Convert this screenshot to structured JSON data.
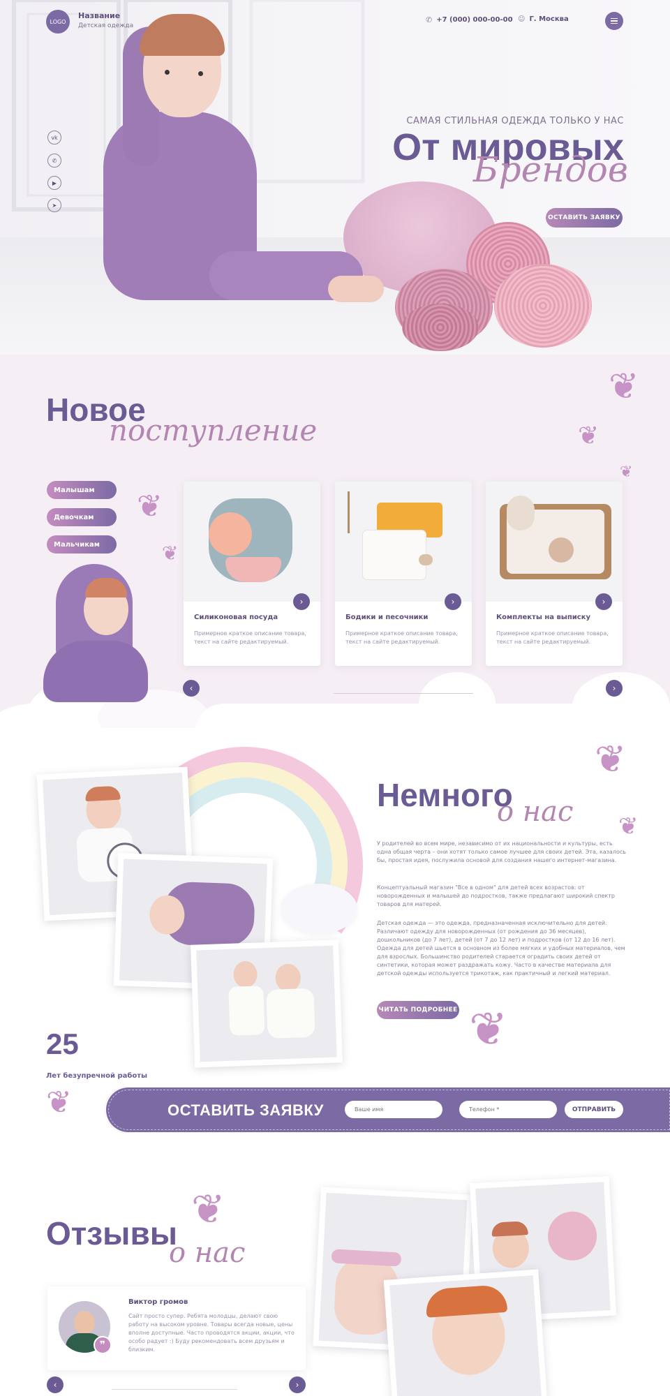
{
  "header": {
    "logo": "LOGO",
    "brand_name": "Название",
    "brand_sub": "Детская одежда",
    "phone": "+7 (000) 000-00-00",
    "city": "Г. Москва"
  },
  "social": [
    "vk-icon",
    "whatsapp-icon",
    "youtube-icon",
    "telegram-icon"
  ],
  "hero": {
    "kicker": "САМАЯ СТИЛЬНАЯ ОДЕЖДА ТОЛЬКО У НАС",
    "title": "От мировых",
    "script": "Брендов",
    "button": "ОСТАВИТЬ ЗАЯВКУ"
  },
  "arrivals": {
    "title": "Новое",
    "script": "поступление",
    "categories": [
      "Малышам",
      "Девочкам",
      "Мальчикам"
    ],
    "cards": [
      {
        "title": "Силиконовая посуда",
        "desc": "Примерное краткое описание товара, текст на сайте редактируемый."
      },
      {
        "title": "Бодики и песочники",
        "desc": "Примерное краткое описание товара, текст на сайте редактируемый."
      },
      {
        "title": "Комплекты на выписку",
        "desc": "Примерное краткое описание товара, текст на сайте редактируемый."
      }
    ]
  },
  "about": {
    "title": "Немного",
    "script": "о нас",
    "p1": "У родителей во всем мире, независимо от их национальности и культуры, есть одна общая черта – они хотят только самое лучшее для своих детей. Эта, казалось бы, простая идея, послужила основой для создания нашего интернет-магазина.",
    "p2": "Концептуальный магазин \"Все в одном\" для детей всех возрастов: от новорожденных и малышей до подростков, также предлагают широкий спектр товаров для матерей.",
    "p3": "Детская одежда — это одежда, предназначенная исключительно для детей. Различают одежду для новорожденных (от рождения до 36 месяцев), дошкольников (до 7 лет), детей (от 7 до 12 лет) и подростков (от 12 до 16 лет). Одежда для детей шьется в основном из более мягких и удобных материалов, чем для взрослых. Большинство родителей старается оградить своих детей от синтетики, которая может раздражать кожу. Часто в качестве материала для детской одежды используется трикотаж, как практичный и легкий материал.",
    "button": "ЧИТАТЬ ПОДРОБНЕЕ",
    "years": "25",
    "years_label": "Лет безупречной работы"
  },
  "request": {
    "title": "ОСТАВИТЬ ЗАЯВКУ",
    "name_placeholder": "Ваше имя",
    "phone_placeholder": "Телефон *",
    "send": "ОТПРАВИТЬ"
  },
  "reviews": {
    "title": "Отзывы",
    "script": "о нас",
    "name": "Виктор громов",
    "text": "Сайт просто супер. Ребята молодцы, делают свою работу на высоком уровне. Товары всегда новые, цены вполне доступные. Часто проводятся акции, акции, что особо радует :) Буду рекомендовать всем друзьям и близким."
  },
  "colors": {
    "brand": "#6b5b95",
    "accent": "#b386b1",
    "pink": "#c48cbf",
    "section_bg": "#f5eef4"
  }
}
